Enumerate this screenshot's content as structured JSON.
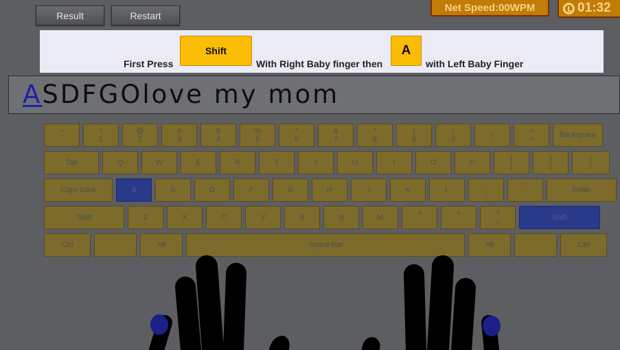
{
  "toolbar": {
    "result_label": "Result",
    "restart_label": "Restart"
  },
  "stats": {
    "net_speed": "Net Speed:00WPM",
    "timer": "01:32"
  },
  "instruction": {
    "first_press": "First Press",
    "key1": "Shift",
    "with_right": "With Right Baby finger then",
    "key2": "A",
    "with_left": "with Left Baby Finger"
  },
  "typing": {
    "current_char": "A",
    "remaining_text": "SDFGOlove my mom"
  },
  "keyboard": {
    "highlighted": [
      "A",
      "Shift-right"
    ],
    "rows": [
      [
        {
          "top": "~",
          "bottom": "`"
        },
        {
          "top": "!",
          "bottom": "1"
        },
        {
          "top": "@",
          "bottom": "2"
        },
        {
          "top": "#",
          "bottom": "3"
        },
        {
          "top": "$",
          "bottom": "4"
        },
        {
          "top": "%",
          "bottom": "5"
        },
        {
          "top": "^",
          "bottom": "6"
        },
        {
          "top": "&",
          "bottom": "7"
        },
        {
          "top": "*",
          "bottom": "8"
        },
        {
          "top": "(",
          "bottom": "9"
        },
        {
          "top": ")",
          "bottom": "0"
        },
        {
          "top": "_",
          "bottom": "-"
        },
        {
          "top": "+",
          "bottom": "="
        },
        {
          "label": "Backspace"
        }
      ],
      [
        {
          "label": "Tab"
        },
        {
          "label": "Q"
        },
        {
          "label": "W"
        },
        {
          "label": "E"
        },
        {
          "label": "R"
        },
        {
          "label": "T"
        },
        {
          "label": "Y"
        },
        {
          "label": "U"
        },
        {
          "label": "I"
        },
        {
          "label": "O"
        },
        {
          "label": "P"
        },
        {
          "top": "{",
          "bottom": "["
        },
        {
          "top": "}",
          "bottom": "]"
        },
        {
          "top": "|",
          "bottom": "\\"
        }
      ],
      [
        {
          "label": "Caps Lock"
        },
        {
          "label": "A"
        },
        {
          "label": "S"
        },
        {
          "label": "D"
        },
        {
          "label": "F"
        },
        {
          "label": "G"
        },
        {
          "label": "H"
        },
        {
          "label": "J"
        },
        {
          "label": "K"
        },
        {
          "label": "L"
        },
        {
          "top": ":",
          "bottom": ";"
        },
        {
          "top": "\"",
          "bottom": "'"
        },
        {
          "label": "Enter"
        }
      ],
      [
        {
          "label": "Shift"
        },
        {
          "label": "Z"
        },
        {
          "label": "X"
        },
        {
          "label": "C"
        },
        {
          "label": "V"
        },
        {
          "label": "B"
        },
        {
          "label": "N"
        },
        {
          "label": "M"
        },
        {
          "top": "<",
          "bottom": ","
        },
        {
          "top": ">",
          "bottom": "."
        },
        {
          "top": "?",
          "bottom": "/"
        },
        {
          "label": "Shift"
        }
      ],
      [
        {
          "label": "Ctrl"
        },
        {
          "label": ""
        },
        {
          "label": "Alt"
        },
        {
          "label": "Space bar"
        },
        {
          "label": "Alt"
        },
        {
          "label": ""
        },
        {
          "label": "Ctrl"
        }
      ]
    ]
  },
  "colors": {
    "key": "#7c6b2b",
    "key_highlight": "#2a3a8a",
    "instruction_key": "#fbbc04",
    "finger_tip": "#1a1f8a"
  }
}
